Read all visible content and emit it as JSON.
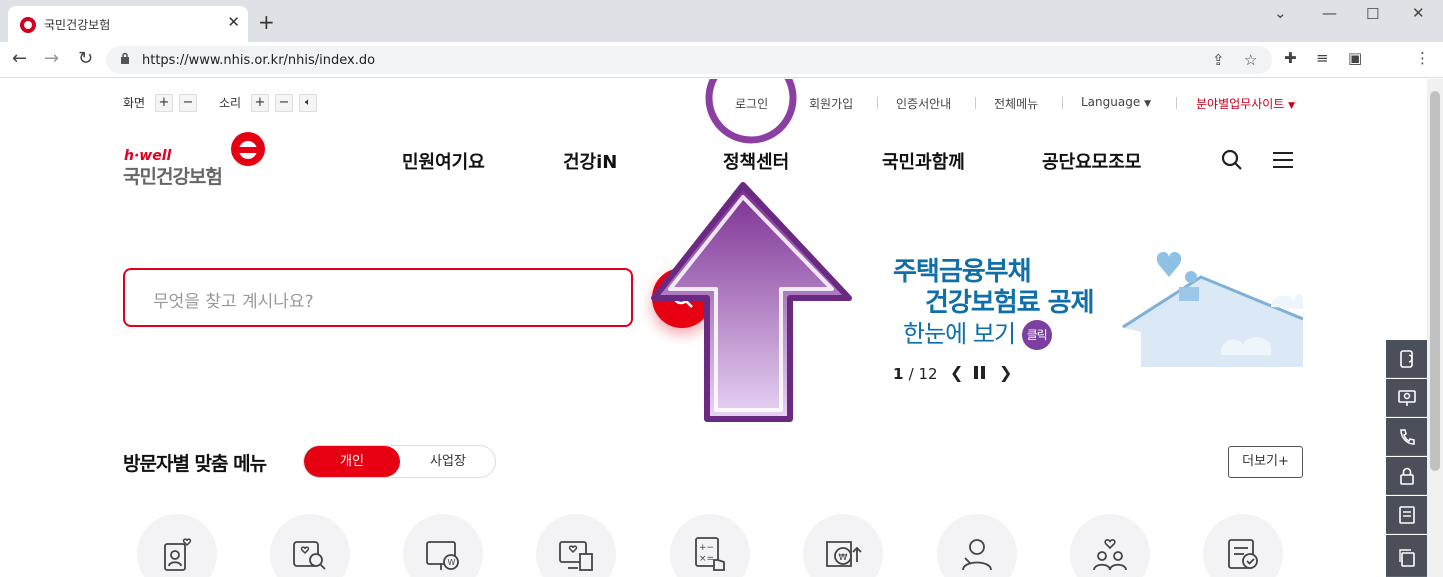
{
  "browser": {
    "tab_title": "국민건강보험",
    "url": "https://www.nhis.or.kr/nhis/index.do"
  },
  "util": {
    "screen_label": "화면",
    "sound_label": "소리",
    "plus": "+",
    "minus": "−"
  },
  "topnav": {
    "login": "로그인",
    "join": "회원가입",
    "cert": "인증서안내",
    "allmenu": "전체메뉴",
    "language": "Language",
    "business": "분야별업무사이트"
  },
  "logo": {
    "sub": "h·well",
    "name": "국민건강보험"
  },
  "gnb": [
    "민원여기요",
    "건강iN",
    "정책센터",
    "국민과함께",
    "공단요모조모"
  ],
  "search": {
    "placeholder": "무엇을 찾고 계시나요?"
  },
  "banner": {
    "line1": "주택금융부채",
    "line2": "건강보험료 공제",
    "line3": "한눈에 보기",
    "click": "클릭",
    "current": "1",
    "total": "/ 12"
  },
  "visitor": {
    "title": "방문자별 맞춤 메뉴",
    "tab_personal": "개인",
    "tab_business": "사업장",
    "more": "더보기+"
  },
  "colors": {
    "brand": "#e60012",
    "purple": "#7b3fa0",
    "banner_blue": "#0f6fa8"
  }
}
